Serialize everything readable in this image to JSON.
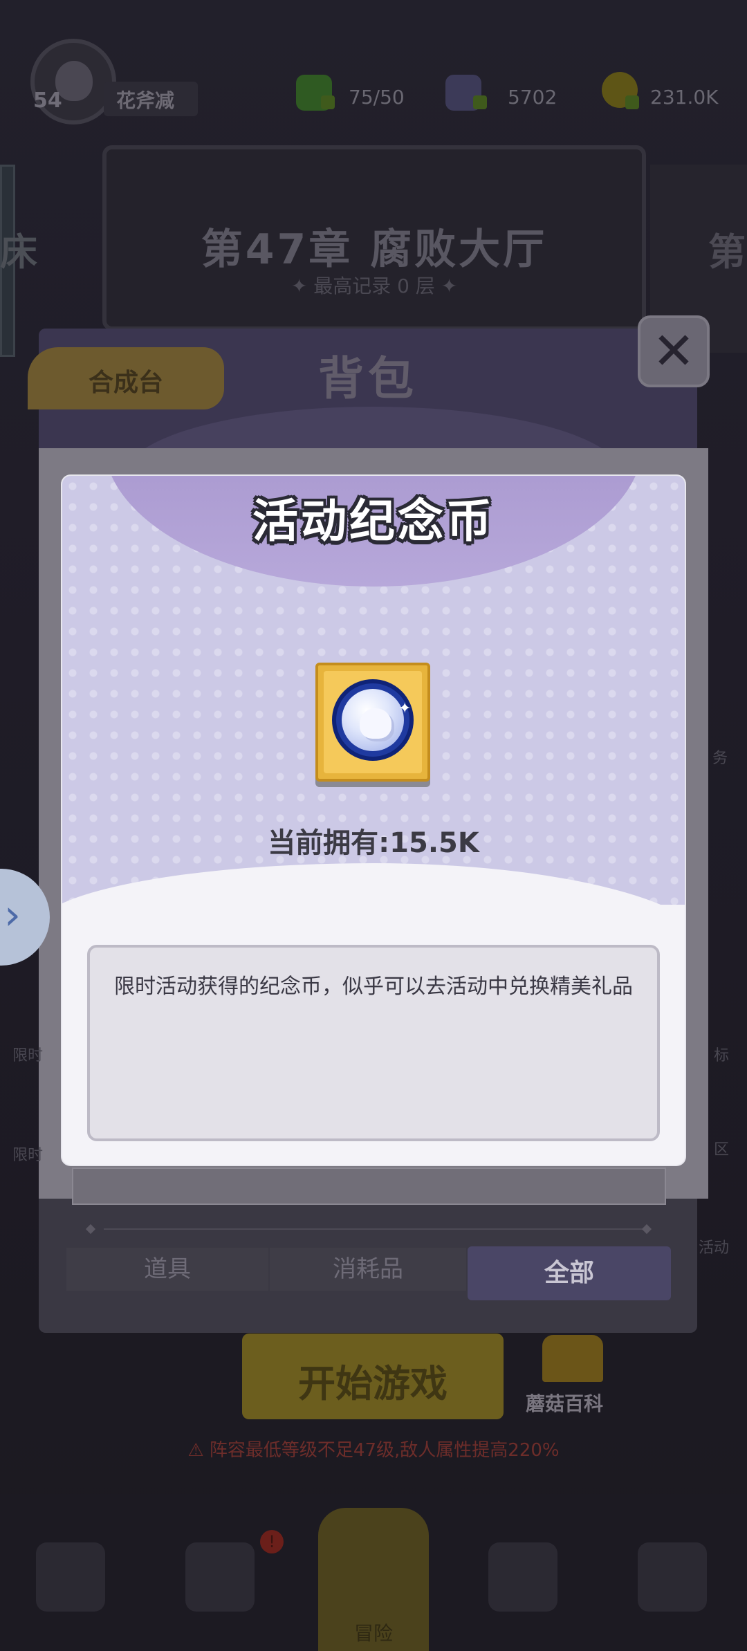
{
  "status_bar": {
    "level": "54",
    "player_name": "花斧减",
    "energy": "75/50",
    "gems": "5702",
    "gold": "231.0K"
  },
  "chapter": {
    "title": "第47章 腐败大厅",
    "subtitle": "✦ 最高记录 0 层 ✦",
    "left_peek": "床",
    "right_peek": "第"
  },
  "backpack": {
    "title": "背包",
    "craft_tab": "合成台",
    "close_symbol": "✕",
    "tabs": [
      "道具",
      "消耗品",
      "全部"
    ]
  },
  "home": {
    "start_button": "开始游戏",
    "encyclopedia": "蘑菇百科",
    "warning": "⚠ 阵容最低等级不足47级,敌人属性提高220%",
    "nav_adventure": "冒险",
    "nav_badge": "!",
    "left_labels": [
      "限时",
      "限时"
    ],
    "right_labels": [
      "标",
      "区",
      "活动",
      "务"
    ]
  },
  "popup": {
    "title": "活动纪念币",
    "item_icon": "memorial-coin-icon",
    "owned": "当前拥有:15.5K",
    "description": "限时活动获得的纪念币，似乎可以去活动中兑换精美礼品"
  },
  "colors": {
    "popup_header": "#ccc9e6",
    "popup_arc": "#9a88c4",
    "item_frame": "#e7b43c",
    "coin": "#1f3aa0"
  }
}
